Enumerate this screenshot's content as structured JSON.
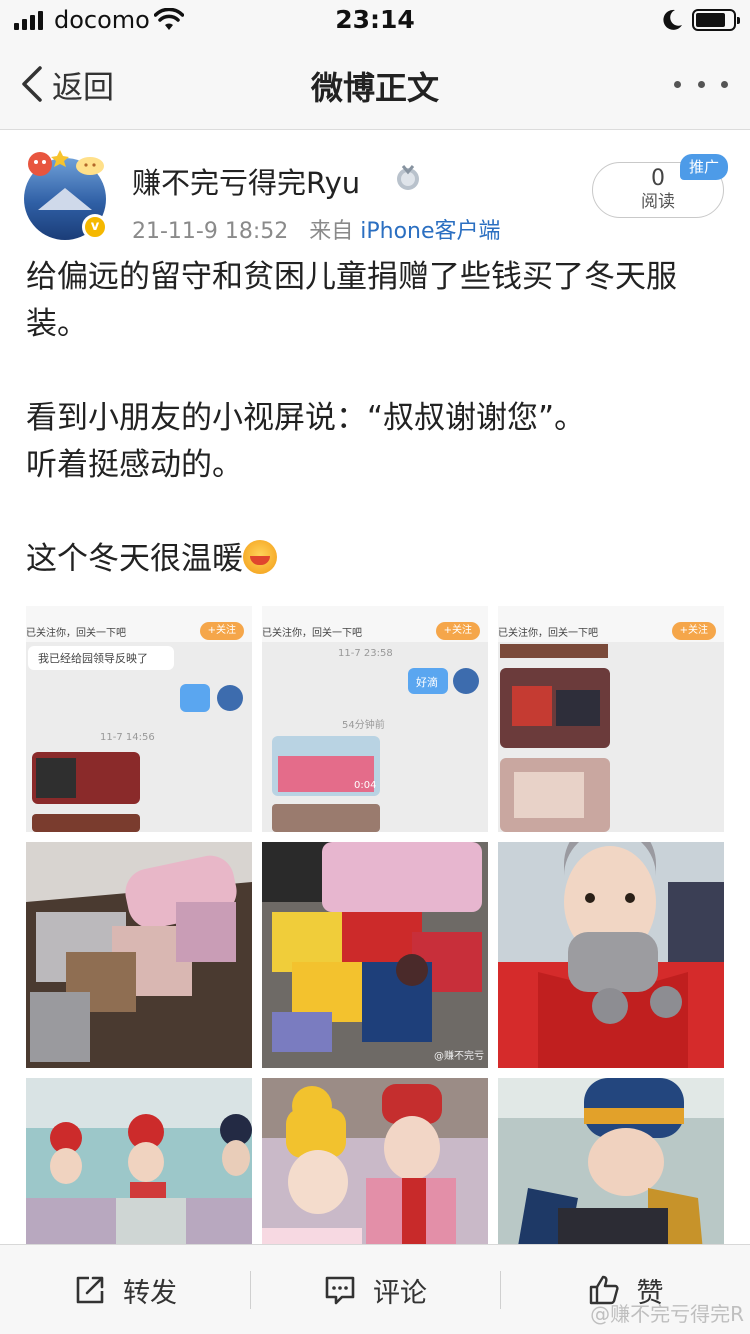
{
  "status_bar": {
    "carrier": "docomo",
    "time": "23:14",
    "battery_level": 0.8
  },
  "nav": {
    "back_label": "返回",
    "title": "微博正文"
  },
  "author": {
    "name": "赚不完亏得完Ryu",
    "timestamp": "21-11-9 18:52",
    "source_prefix": "来自",
    "source": "iPhone客户端"
  },
  "read_count": {
    "value": "0",
    "label": "阅读",
    "promo_badge": "推广"
  },
  "post": {
    "paragraphs": [
      "给偏远的留守和贫困儿童捐赠了些钱买了冬天服装。",
      "",
      "看到小朋友的小视屏说：“叔叔谢谢您”。",
      "听着挺感动的。",
      "",
      "这个冬天很温暖"
    ]
  },
  "images": {
    "chat1": {
      "header": "已关注你，回关一下吧",
      "follow": "+关注",
      "bubble": "我已经给园领导反映了",
      "time": "11-7 14:56"
    },
    "chat2": {
      "header": "已关注你，回关一下吧",
      "follow": "+关注",
      "time": "11-7 23:58",
      "bubble": "好滴",
      "ago": "54分钟前",
      "video_duration": "0:04"
    },
    "chat3": {
      "header": "已关注你，回关一下吧",
      "follow": "+关注"
    },
    "watermark1": "@赚不完亏",
    "watermark2": "@赚不完亏"
  },
  "toolbar": {
    "repost": "转发",
    "comment": "评论",
    "like": "赞"
  },
  "page_watermark": "@赚不完亏得完R",
  "colors": {
    "link_blue": "#2b6fc1",
    "promo_blue": "#4d9be8",
    "follow_orange": "#f5a64a",
    "verified_gold": "#f5b800"
  }
}
